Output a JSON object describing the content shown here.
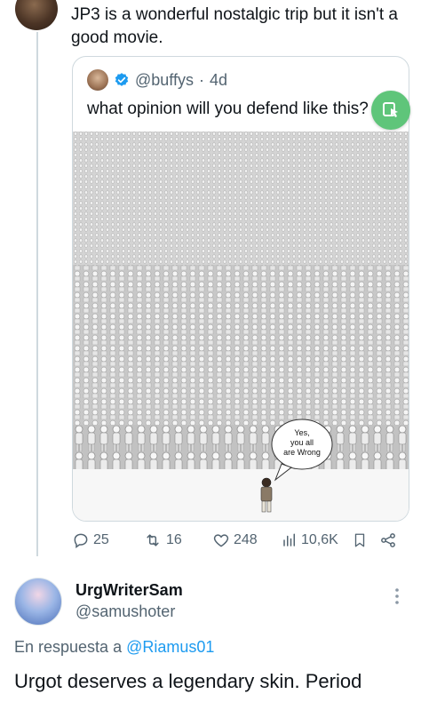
{
  "tweet": {
    "text": "JP3 is a wonderful nostalgic trip but it isn't a good movie."
  },
  "quote": {
    "handle": "@buffys",
    "age": "4d",
    "text": "what opinion will you defend like this?",
    "image_caption": "Yes, you all are Wrong"
  },
  "actions": {
    "replies": "25",
    "retweets": "16",
    "likes": "248",
    "views": "10,6K"
  },
  "reply": {
    "author_name": "UrgWriterSam",
    "author_handle": "@samushoter",
    "reply_prefix": "En respuesta a",
    "reply_target": "@Riamus01",
    "text": "Urgot deserves a legendary skin. Period"
  },
  "colors": {
    "link": "#1d9bf0",
    "muted": "#536471",
    "text": "#0f1419",
    "floating_button": "#5fc57a"
  }
}
